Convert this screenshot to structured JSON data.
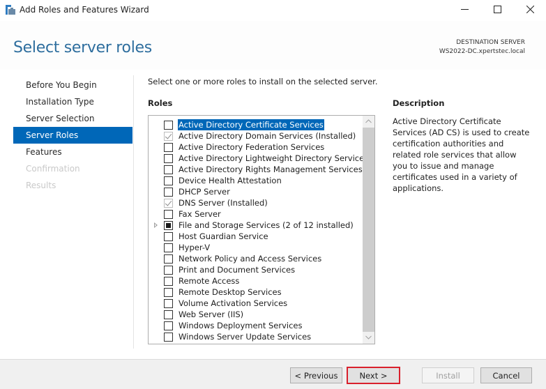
{
  "window": {
    "title": "Add Roles and Features Wizard",
    "controls": {
      "minimize": "—",
      "maximize": "☐",
      "close": "✕"
    }
  },
  "header": {
    "page_title": "Select server roles",
    "destination_label": "DESTINATION SERVER",
    "destination_server": "WS2022-DC.xpertstec.local"
  },
  "nav": {
    "items": [
      {
        "label": "Before You Begin",
        "state": "normal"
      },
      {
        "label": "Installation Type",
        "state": "normal"
      },
      {
        "label": "Server Selection",
        "state": "normal"
      },
      {
        "label": "Server Roles",
        "state": "active"
      },
      {
        "label": "Features",
        "state": "normal"
      },
      {
        "label": "Confirmation",
        "state": "disabled"
      },
      {
        "label": "Results",
        "state": "disabled"
      }
    ]
  },
  "main": {
    "instruction": "Select one or more roles to install on the selected server.",
    "roles_label": "Roles",
    "roles": [
      {
        "label": "Active Directory Certificate Services",
        "state": "unchecked",
        "selected": true
      },
      {
        "label": "Active Directory Domain Services (Installed)",
        "state": "checked-disabled"
      },
      {
        "label": "Active Directory Federation Services",
        "state": "unchecked"
      },
      {
        "label": "Active Directory Lightweight Directory Services",
        "state": "unchecked"
      },
      {
        "label": "Active Directory Rights Management Services",
        "state": "unchecked"
      },
      {
        "label": "Device Health Attestation",
        "state": "unchecked"
      },
      {
        "label": "DHCP Server",
        "state": "unchecked"
      },
      {
        "label": "DNS Server (Installed)",
        "state": "checked-disabled"
      },
      {
        "label": "Fax Server",
        "state": "unchecked"
      },
      {
        "label": "File and Storage Services (2 of 12 installed)",
        "state": "partial",
        "expandable": true
      },
      {
        "label": "Host Guardian Service",
        "state": "unchecked"
      },
      {
        "label": "Hyper-V",
        "state": "unchecked"
      },
      {
        "label": "Network Policy and Access Services",
        "state": "unchecked"
      },
      {
        "label": "Print and Document Services",
        "state": "unchecked"
      },
      {
        "label": "Remote Access",
        "state": "unchecked"
      },
      {
        "label": "Remote Desktop Services",
        "state": "unchecked"
      },
      {
        "label": "Volume Activation Services",
        "state": "unchecked"
      },
      {
        "label": "Web Server (IIS)",
        "state": "unchecked"
      },
      {
        "label": "Windows Deployment Services",
        "state": "unchecked"
      },
      {
        "label": "Windows Server Update Services",
        "state": "unchecked"
      }
    ],
    "scroll_up": "⌃",
    "scroll_down": "⌄"
  },
  "description": {
    "title": "Description",
    "text": "Active Directory Certificate Services (AD CS) is used to create certification authorities and related role services that allow you to issue and manage certificates used in a variety of applications."
  },
  "footer": {
    "previous": "< Previous",
    "next": "Next >",
    "install": "Install",
    "cancel": "Cancel"
  },
  "colors": {
    "accent": "#0067b8",
    "title": "#2e6e9e",
    "highlight_border": "#d9202c"
  }
}
